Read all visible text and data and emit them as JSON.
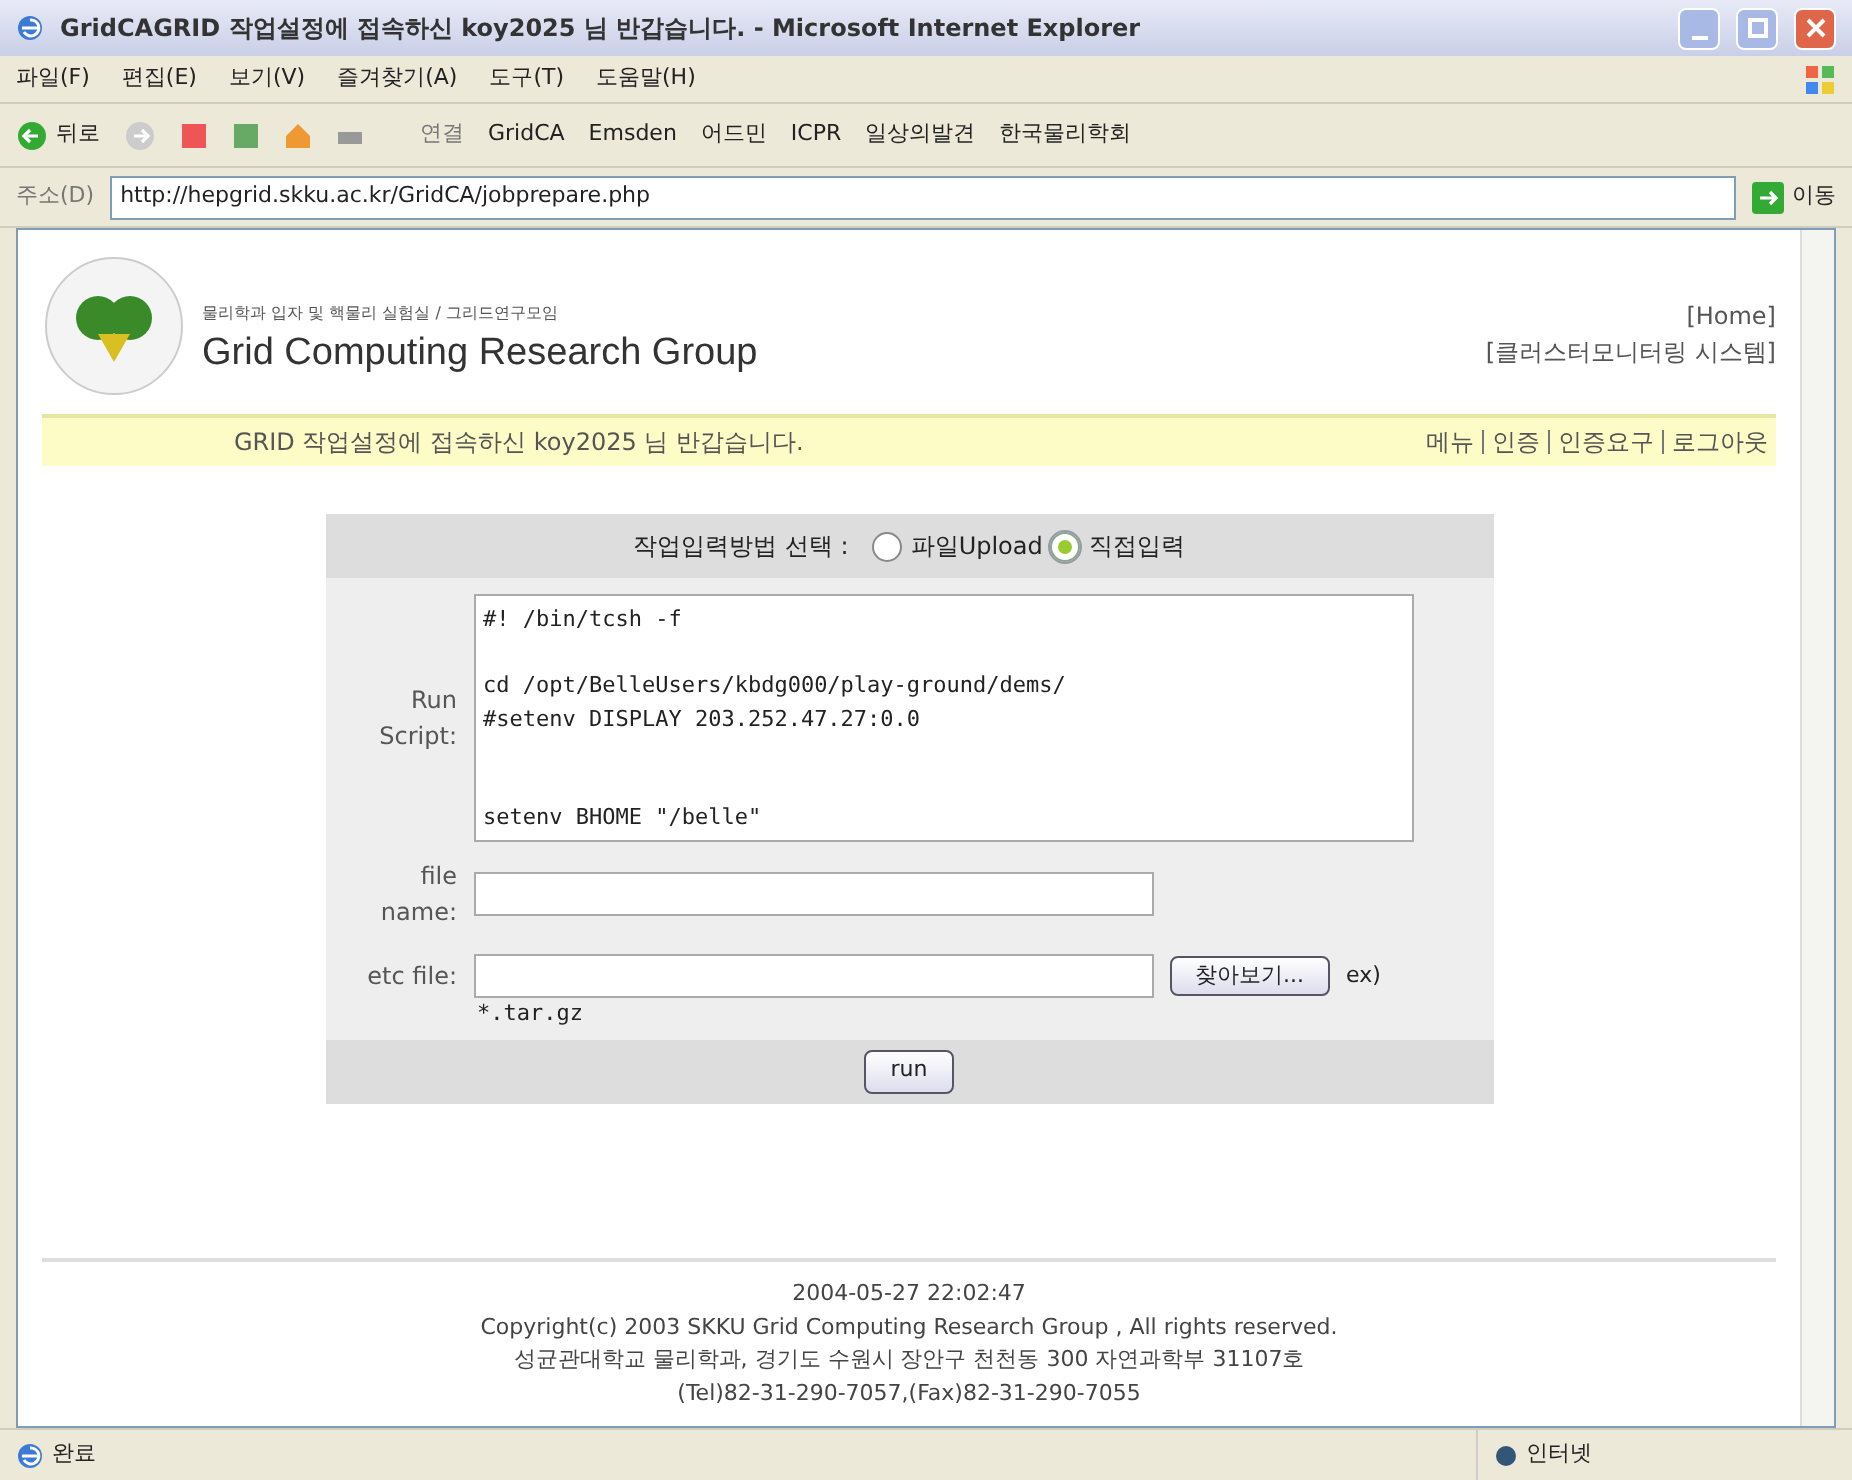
{
  "window": {
    "title": "GridCAGRID 작업설정에 접속하신 koy2025 님 반갑습니다. - Microsoft Internet Explorer"
  },
  "menu": [
    "파일(F)",
    "편집(E)",
    "보기(V)",
    "즐겨찾기(A)",
    "도구(T)",
    "도움말(H)"
  ],
  "toolbar": {
    "back": "뒤로",
    "links_label": "연결",
    "links": [
      "GridCA",
      "Emsden",
      "어드민",
      "ICPR",
      "일상의발견",
      "한국물리학회"
    ]
  },
  "address_bar": {
    "label": "주소(D)",
    "url": "http://hepgrid.skku.ac.kr/GridCA/jobprepare.php",
    "go": "이동"
  },
  "header": {
    "subtitle": "물리학과 입자 및 핵물리 실험실 / 그리드연구모임",
    "title": "Grid Computing Research Group",
    "links": [
      "[Home]",
      "[클러스터모니터링 시스템]"
    ]
  },
  "banner": {
    "welcome": "GRID 작업설정에 접속하신 koy2025 님 반갑습니다.",
    "links": [
      "메뉴",
      "인증",
      "인증요구",
      "로그아웃"
    ]
  },
  "form": {
    "method_label": "작업입력방법 선택 :",
    "methods": [
      {
        "label": "파일Upload",
        "selected": false
      },
      {
        "label": "직접입력",
        "selected": true
      }
    ],
    "script_label": "Run Script:",
    "script": "#! /bin/tcsh -f\n\ncd /opt/BelleUsers/kbdg000/play-ground/dems/\n#setenv DISPLAY 203.252.47.27:0.0\n\n\nsetenv BHOME \"/belle\"",
    "file_name_label": "file name:",
    "etc_file_label": "etc file:",
    "browse": "찾아보기...",
    "example": "ex)",
    "example_value": "*.tar.gz",
    "run": "run"
  },
  "footer": [
    "2004-05-27 22:02:47",
    "Copyright(c) 2003 SKKU Grid Computing Research Group , All rights reserved.",
    "성균관대학교 물리학과, 경기도 수원시 장안구 천천동 300 자연과학부 31107호",
    "(Tel)82-31-290-7057,(Fax)82-31-290-7055"
  ],
  "status_bar": {
    "text": "완료",
    "zone": "인터넷"
  }
}
